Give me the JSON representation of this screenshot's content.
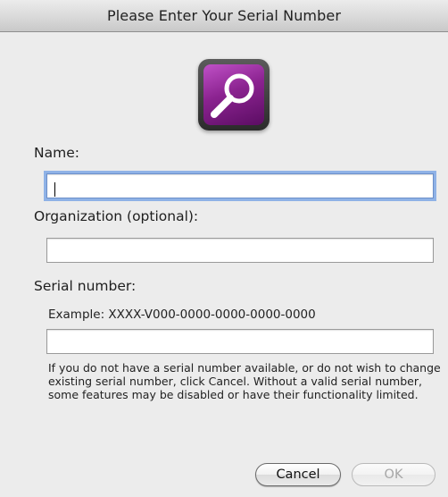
{
  "window": {
    "title": "Please Enter Your Serial Number"
  },
  "icons": {
    "app_icon": "magnifying-glass-icon"
  },
  "form": {
    "name_label": "Name:",
    "name_value": "",
    "organization_label": "Organization (optional):",
    "organization_value": "",
    "serial_label": "Serial number:",
    "serial_example": "Example: XXXX-V000-0000-0000-0000-0000",
    "serial_value": "",
    "help_text": "If you do not have a serial number available, or do not wish to change existing serial number, click Cancel. Without a valid serial number, some features may be disabled or have their functionality limited."
  },
  "buttons": {
    "cancel_label": "Cancel",
    "ok_label": "OK",
    "ok_enabled": false
  },
  "colors": {
    "icon_purple": "#8b2390",
    "focus_ring": "#8fb2e6"
  }
}
